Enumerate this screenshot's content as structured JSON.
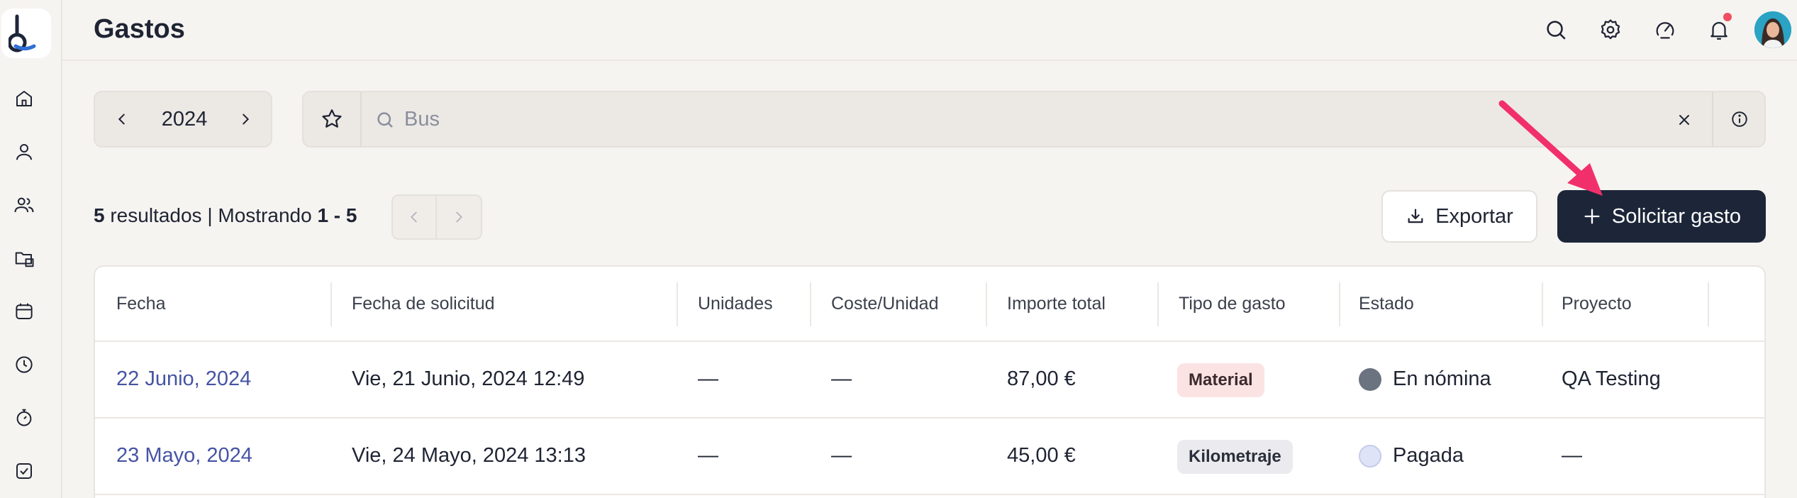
{
  "header": {
    "title": "Gastos"
  },
  "filters": {
    "year": "2024",
    "search_value": "",
    "search_placeholder": "Bus"
  },
  "results": {
    "count": "5",
    "count_label": " resultados",
    "separator": " | Mostrando ",
    "range": "1 - 5"
  },
  "actions": {
    "export_label": "Exportar",
    "request_label": "Solicitar gasto"
  },
  "table": {
    "columns": [
      "Fecha",
      "Fecha de solicitud",
      "Unidades",
      "Coste/Unidad",
      "Importe total",
      "Tipo de gasto",
      "Estado",
      "Proyecto"
    ],
    "rows": [
      {
        "fecha": "22 Junio, 2024",
        "solicitud": "Vie, 21 Junio, 2024 12:49",
        "unidades": "—",
        "coste": "—",
        "importe": "87,00 €",
        "tipo": "Material",
        "estado": "En nómina",
        "estado_color": "#6b7280",
        "proyecto": "QA Testing"
      },
      {
        "fecha": "23 Mayo, 2024",
        "solicitud": "Vie, 24 Mayo, 2024 13:13",
        "unidades": "—",
        "coste": "—",
        "importe": "45,00 €",
        "tipo": "Kilometraje",
        "estado": "Pagada",
        "estado_color": "#dfe3f7",
        "proyecto": "—"
      }
    ]
  },
  "icons": {
    "sidebar": [
      "home-icon",
      "user-icon",
      "users-icon",
      "folders-icon",
      "calendar-icon",
      "clock-icon",
      "stopwatch-icon",
      "checkbox-icon"
    ],
    "header": [
      "search-icon",
      "settings-icon",
      "speed-icon",
      "bell-icon"
    ]
  },
  "colors": {
    "accent": "#1d2639",
    "link": "#4654a3",
    "notification": "#ef4f5f",
    "arrow": "#f1306b",
    "brand_blue": "#2f6fd6"
  }
}
